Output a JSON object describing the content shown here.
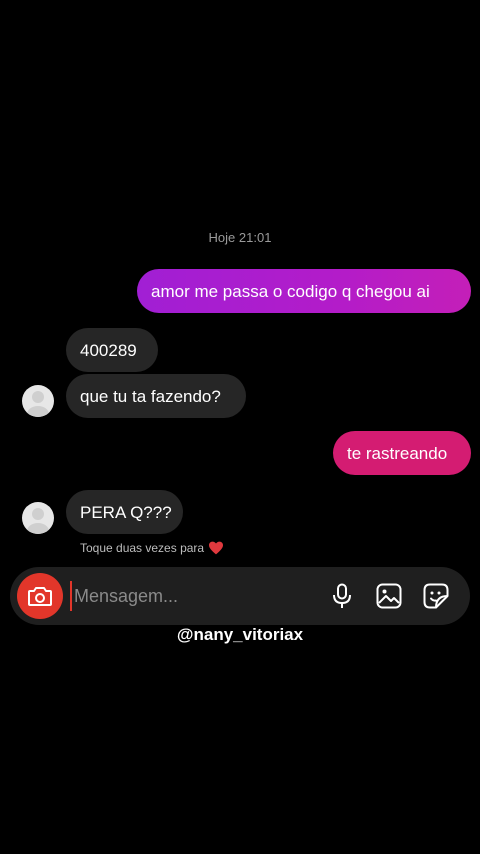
{
  "chat": {
    "timestamp": "Hoje 21:01",
    "messages": [
      {
        "from": "me",
        "text": "amor me passa o codigo q chegou ai"
      },
      {
        "from": "them",
        "text": "400289"
      },
      {
        "from": "them",
        "text": "que tu ta fazendo?"
      },
      {
        "from": "me",
        "text": "te rastreando"
      },
      {
        "from": "them",
        "text": "PERA Q???"
      }
    ],
    "hint": "Toque duas vezes para"
  },
  "composer": {
    "placeholder": "Mensagem..."
  },
  "icons": {
    "camera": "camera-icon",
    "mic": "microphone-icon",
    "gallery": "gallery-icon",
    "sticker": "sticker-icon",
    "heart": "heart-icon"
  },
  "colors": {
    "sent_bubble": "#a11fd4",
    "sent_bubble_alt": "#d41c72",
    "received_bubble": "#262626",
    "camera_button": "#e2362a",
    "heart": "#e0393e"
  },
  "watermark": "@nany_vitoriax"
}
